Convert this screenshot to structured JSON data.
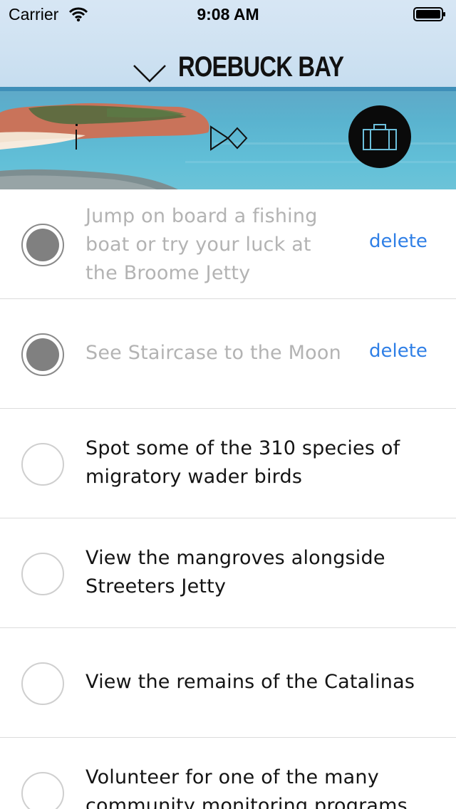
{
  "status_bar": {
    "carrier": "Carrier",
    "time": "9:08 AM"
  },
  "header": {
    "title": "ROEBUCK BAY",
    "icons": [
      "chevron-down-icon",
      "info-icon",
      "bowtie-icon",
      "suitcase-icon"
    ]
  },
  "colors": {
    "delete_link": "#2f7fe6",
    "completed_text": "#b3b3b3",
    "completed_check": "#808080",
    "suitcase_button_bg": "#0a0a0a"
  },
  "activities": [
    {
      "text": "Jump on board a fishing boat or try your luck at the Broome Jetty",
      "completed": true,
      "action": "delete"
    },
    {
      "text": "See Staircase to the Moon",
      "completed": true,
      "action": "delete"
    },
    {
      "text": "Spot some of the 310 species of migratory wader birds",
      "completed": false
    },
    {
      "text": "View the mangroves alongside Streeters Jetty",
      "completed": false
    },
    {
      "text": "View the remains of the Catalinas",
      "completed": false
    },
    {
      "text": "Volunteer for one of the many community monitoring programs",
      "completed": false
    }
  ]
}
